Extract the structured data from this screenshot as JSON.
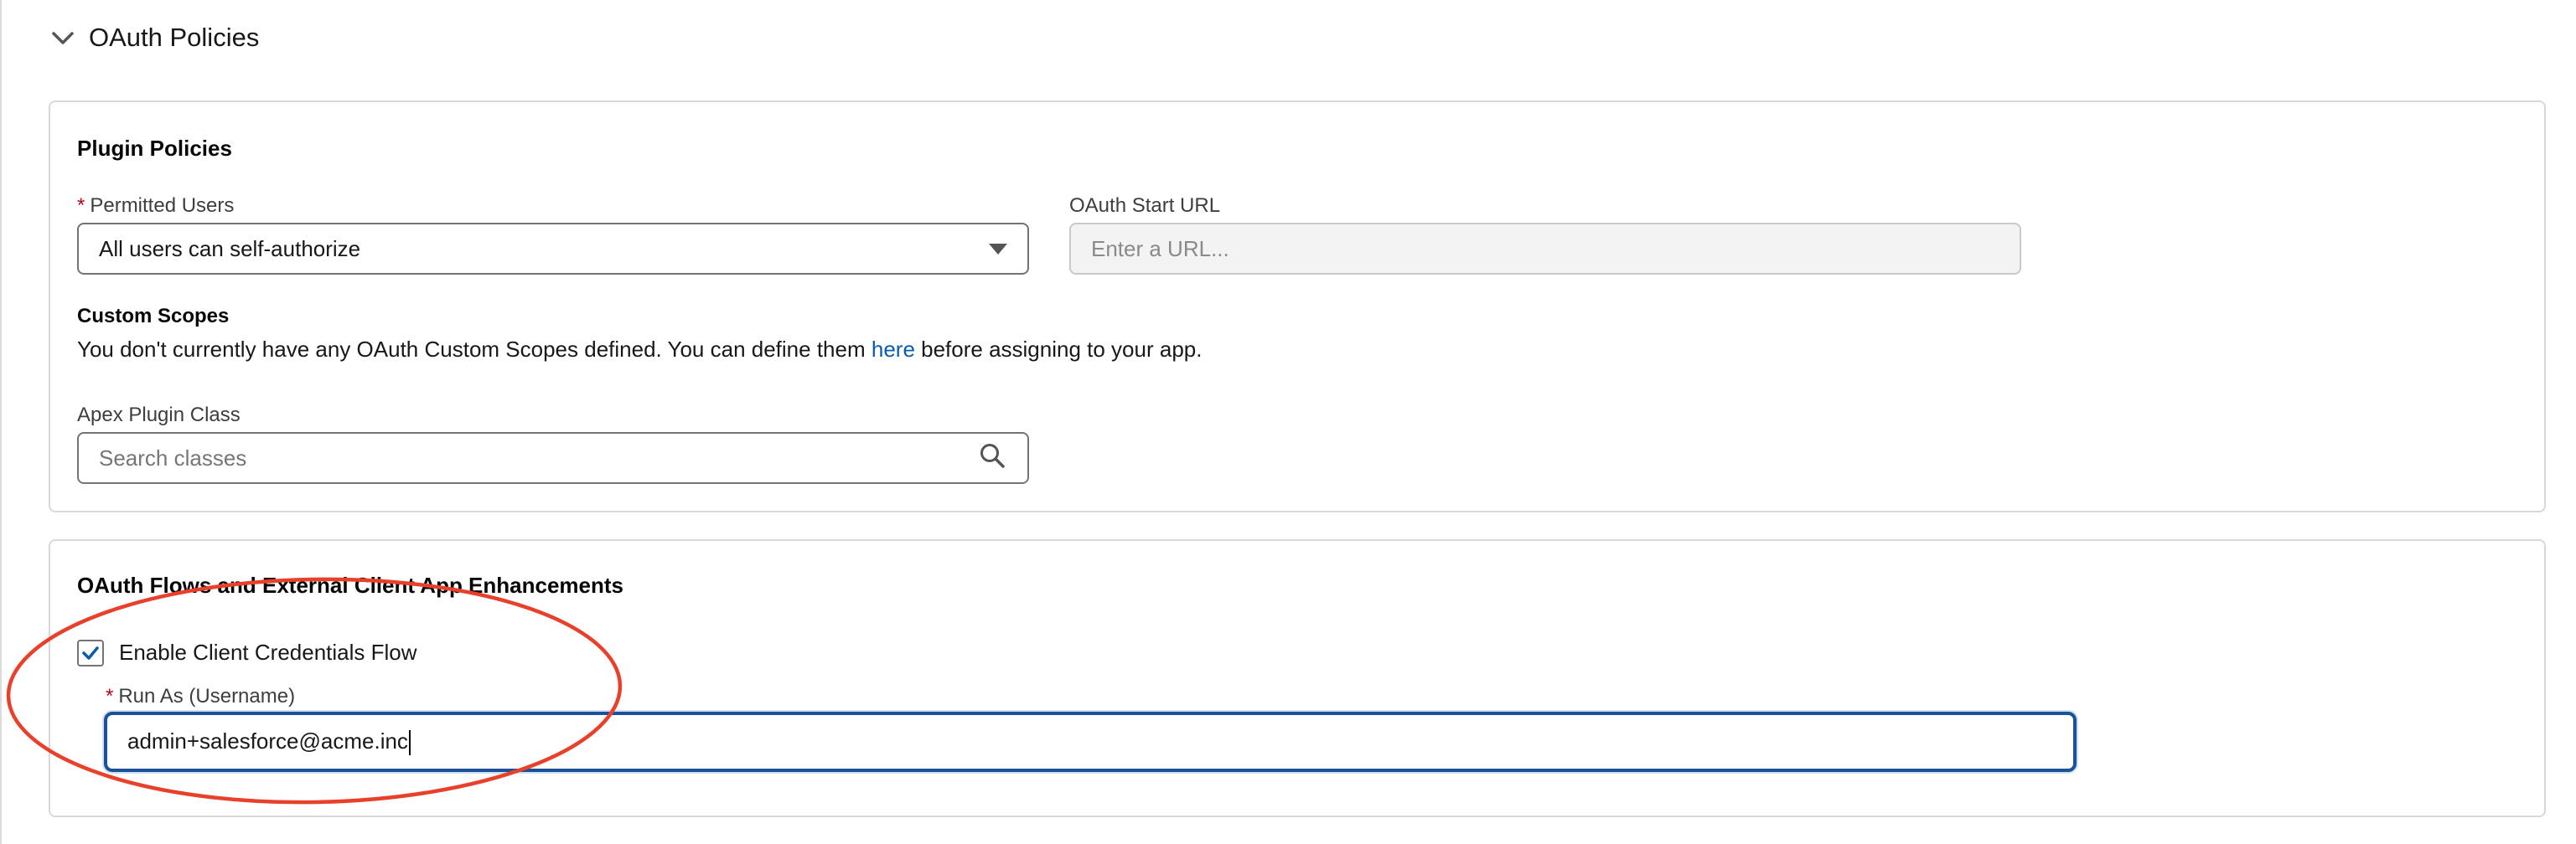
{
  "section": {
    "title": "OAuth Policies",
    "chevron_icon": "chevron-down-icon"
  },
  "plugin_policies": {
    "title": "Plugin Policies",
    "permitted_users": {
      "required_marker": "*",
      "label": "Permitted Users",
      "selected": "All users can self-authorize",
      "icon": "dropdown-arrow-icon"
    },
    "oauth_start_url": {
      "label": "OAuth Start URL",
      "placeholder": "Enter a URL...",
      "disabled": true
    },
    "custom_scopes": {
      "title": "Custom Scopes",
      "text_before": "You don't currently have any OAuth Custom Scopes defined. You can define them ",
      "link": "here",
      "text_after": " before assigning to your app."
    },
    "apex_plugin_class": {
      "label": "Apex Plugin Class",
      "placeholder": "Search classes",
      "icon": "search-icon"
    }
  },
  "oauth_flows": {
    "title": "OAuth Flows and External Client App Enhancements",
    "client_credentials": {
      "label": "Enable Client Credentials Flow",
      "checked": true
    },
    "run_as": {
      "required_marker": "*",
      "label": "Run As (Username)",
      "value": "admin+salesforce@acme.inc"
    }
  },
  "colors": {
    "required": "#ba0517",
    "link": "#0b5cab",
    "focus_border": "#1b5297",
    "checkmark": "#0b5cab",
    "annotation": "#e8402a"
  }
}
